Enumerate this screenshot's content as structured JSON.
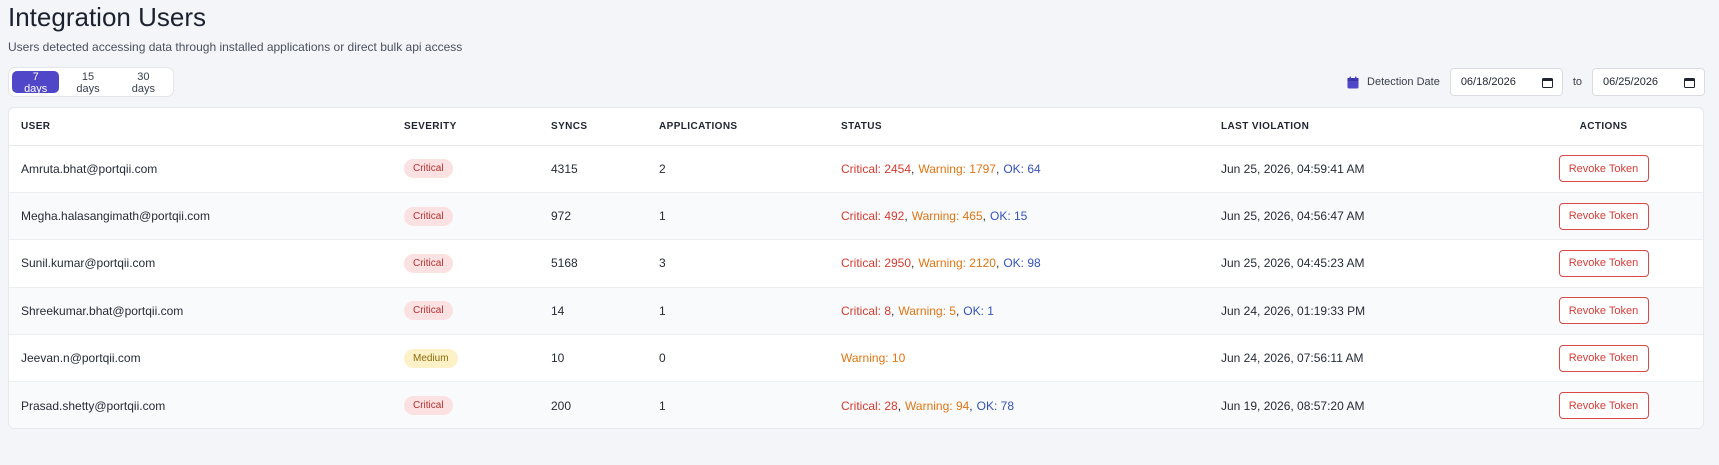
{
  "header": {
    "title": "Integration Users",
    "subtitle": "Users detected accessing data through installed applications or direct bulk api access"
  },
  "range": {
    "options": [
      "7 days",
      "15 days",
      "30 days"
    ],
    "active": "7 days"
  },
  "date_filter": {
    "label": "Detection Date",
    "from": "06/18/2026",
    "to_label": "to",
    "to": "06/25/2026",
    "icon": "calendar-icon"
  },
  "table": {
    "columns": [
      "USER",
      "SEVERITY",
      "SYNCS",
      "APPLICATIONS",
      "STATUS",
      "LAST VIOLATION",
      "ACTIONS"
    ],
    "rows": [
      {
        "user": "Amruta.bhat@portqii.com",
        "severity": "Critical",
        "syncs": "4315",
        "applications": "2",
        "status": [
          {
            "type": "critical",
            "text": "Critical: 2454"
          },
          {
            "type": "warning",
            "text": "Warning: 1797"
          },
          {
            "type": "ok",
            "text": "OK: 64"
          }
        ],
        "last_violation": "Jun 25, 2026, 04:59:41 AM",
        "action": "Revoke Token"
      },
      {
        "user": "Megha.halasangimath@portqii.com",
        "severity": "Critical",
        "syncs": "972",
        "applications": "1",
        "status": [
          {
            "type": "critical",
            "text": "Critical: 492"
          },
          {
            "type": "warning",
            "text": "Warning: 465"
          },
          {
            "type": "ok",
            "text": "OK: 15"
          }
        ],
        "last_violation": "Jun 25, 2026, 04:56:47 AM",
        "action": "Revoke Token"
      },
      {
        "user": "Sunil.kumar@portqii.com",
        "severity": "Critical",
        "syncs": "5168",
        "applications": "3",
        "status": [
          {
            "type": "critical",
            "text": "Critical: 2950"
          },
          {
            "type": "warning",
            "text": "Warning: 2120"
          },
          {
            "type": "ok",
            "text": "OK: 98"
          }
        ],
        "last_violation": "Jun 25, 2026, 04:45:23 AM",
        "action": "Revoke Token"
      },
      {
        "user": "Shreekumar.bhat@portqii.com",
        "severity": "Critical",
        "syncs": "14",
        "applications": "1",
        "status": [
          {
            "type": "critical",
            "text": "Critical: 8"
          },
          {
            "type": "warning",
            "text": "Warning: 5"
          },
          {
            "type": "ok",
            "text": "OK: 1"
          }
        ],
        "last_violation": "Jun 24, 2026, 01:19:33 PM",
        "action": "Revoke Token"
      },
      {
        "user": "Jeevan.n@portqii.com",
        "severity": "Medium",
        "syncs": "10",
        "applications": "0",
        "status": [
          {
            "type": "warning",
            "text": "Warning: 10"
          }
        ],
        "last_violation": "Jun 24, 2026, 07:56:11 AM",
        "action": "Revoke Token"
      },
      {
        "user": "Prasad.shetty@portqii.com",
        "severity": "Critical",
        "syncs": "200",
        "applications": "1",
        "status": [
          {
            "type": "critical",
            "text": "Critical: 28"
          },
          {
            "type": "warning",
            "text": "Warning: 94"
          },
          {
            "type": "ok",
            "text": "OK: 78"
          }
        ],
        "last_violation": "Jun 19, 2026, 08:57:20 AM",
        "action": "Revoke Token"
      }
    ]
  },
  "colors": {
    "accent": "#4f46c8",
    "critical": "#d23b2f",
    "warning": "#e07512",
    "ok": "#3453b8"
  }
}
